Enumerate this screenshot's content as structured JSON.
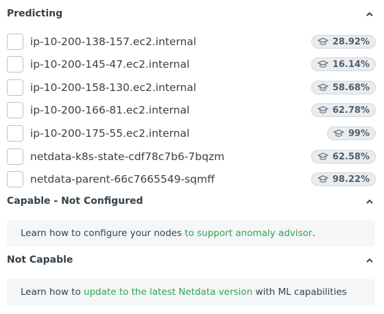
{
  "sections": {
    "predicting": {
      "title": "Predicting",
      "nodes": [
        {
          "name": "ip-10-200-138-157.ec2.internal",
          "score": "28.92%"
        },
        {
          "name": "ip-10-200-145-47.ec2.internal",
          "score": "16.14%"
        },
        {
          "name": "ip-10-200-158-130.ec2.internal",
          "score": "58.68%"
        },
        {
          "name": "ip-10-200-166-81.ec2.internal",
          "score": "62.78%"
        },
        {
          "name": "ip-10-200-175-55.ec2.internal",
          "score": "99%"
        },
        {
          "name": "netdata-k8s-state-cdf78c7b6-7bqzm",
          "score": "62.58%"
        },
        {
          "name": "netdata-parent-66c7665549-sqmff",
          "score": "98.22%"
        }
      ]
    },
    "capable_not_configured": {
      "title": "Capable - Not Configured",
      "text_before": "Learn how to configure your nodes ",
      "link": "to support anomaly advisor",
      "text_after": "."
    },
    "not_capable": {
      "title": "Not Capable",
      "text_before": "Learn how to ",
      "link": "update to the latest Netdata version",
      "text_after": " with ML capabilities"
    }
  },
  "colors": {
    "link": "#2fa34f",
    "text": "#35414a",
    "badge_bg": "#e9edf0",
    "info_bg": "#f4f6f7"
  },
  "icons": {
    "collapse": "chevron-up-icon",
    "score": "graduation-cap-icon"
  }
}
